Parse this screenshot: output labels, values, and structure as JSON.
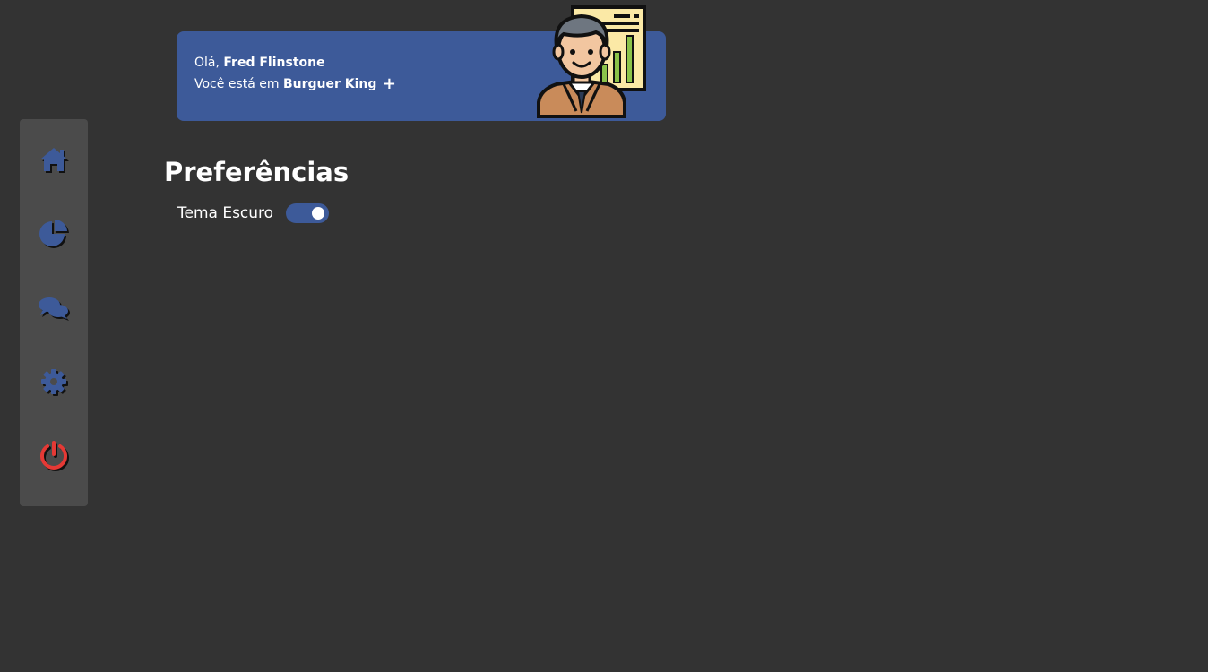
{
  "header": {
    "greeting_prefix": "Olá, ",
    "user_name": "Fred Flinstone",
    "location_prefix": "Você está em ",
    "location_name": "Burguer King",
    "add_location_symbol": "+",
    "avatar_icon": "businessman-chart-icon"
  },
  "sidebar": {
    "items": [
      {
        "icon": "home-icon"
      },
      {
        "icon": "pie-chart-icon"
      },
      {
        "icon": "chat-icon"
      },
      {
        "icon": "gear-icon"
      },
      {
        "icon": "power-icon"
      }
    ]
  },
  "main": {
    "title": "Preferências",
    "preferences": [
      {
        "label": "Tema Escuro",
        "enabled": true
      }
    ]
  },
  "colors": {
    "background": "#333333",
    "sidebar": "#4b4b4b",
    "accent": "#3d5a99",
    "logout": "#e53935"
  }
}
